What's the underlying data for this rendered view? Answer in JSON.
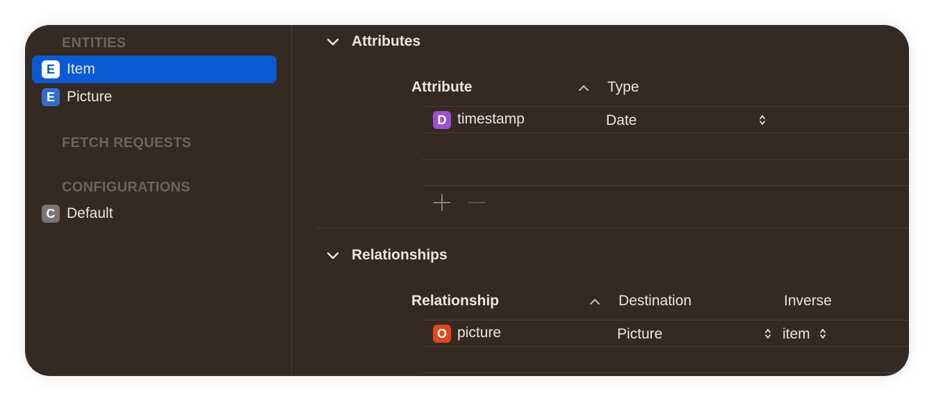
{
  "sidebar": {
    "entities_header": "ENTITIES",
    "entities": [
      {
        "badge": "E",
        "label": "Item",
        "selected": true
      },
      {
        "badge": "E",
        "label": "Picture",
        "selected": false
      }
    ],
    "fetch_requests_header": "FETCH REQUESTS",
    "configurations_header": "CONFIGURATIONS",
    "configurations": [
      {
        "badge": "C",
        "label": "Default"
      }
    ]
  },
  "attributes": {
    "title": "Attributes",
    "columns": {
      "attribute": "Attribute",
      "type": "Type"
    },
    "rows": [
      {
        "badge": "D",
        "name": "timestamp",
        "type": "Date"
      }
    ]
  },
  "relationships": {
    "title": "Relationships",
    "columns": {
      "relationship": "Relationship",
      "destination": "Destination",
      "inverse": "Inverse"
    },
    "rows": [
      {
        "badge": "O",
        "name": "picture",
        "destination": "Picture",
        "inverse": "item"
      }
    ]
  },
  "colors": {
    "window_bg": "#352a21",
    "selection": "#0a5bd3",
    "entity_badge": "#2f6fd0",
    "attribute_badge": "#9b4fd6",
    "relationship_badge": "#e0481c",
    "config_badge": "#7a7570"
  },
  "icons": [
    "chevron-down-icon",
    "sort-ascending-icon",
    "up-down-arrows-icon",
    "plus-icon",
    "minus-icon"
  ]
}
